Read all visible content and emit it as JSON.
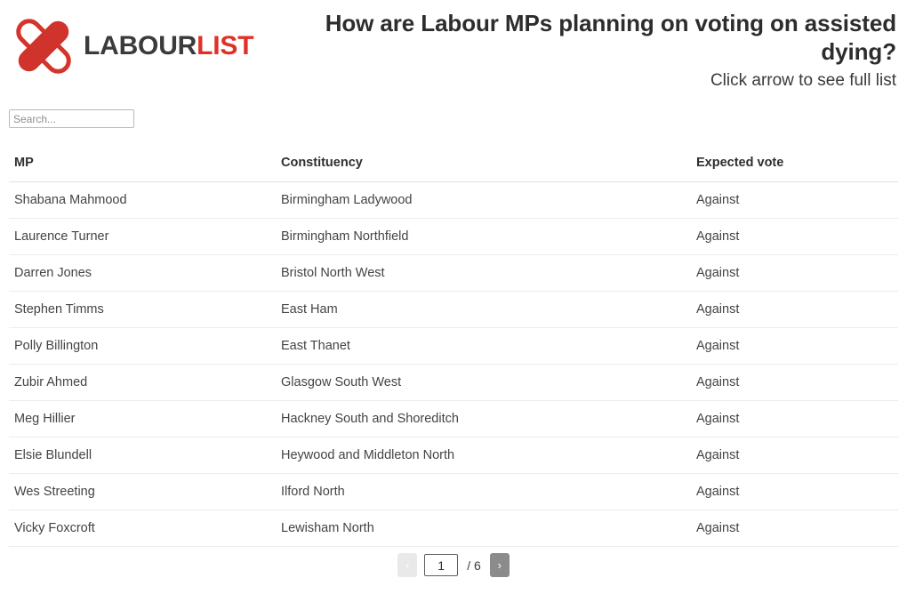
{
  "brand": {
    "logo_icon": "labourlist-x-icon",
    "name_part1": "LABOUR",
    "name_part2": "LIST",
    "color_red": "#e03127",
    "color_dark": "#3b3b3b"
  },
  "header": {
    "title": "How are Labour MPs planning on voting on assisted dying?",
    "subtitle": "Click arrow to see full list"
  },
  "search": {
    "placeholder": "Search...",
    "value": ""
  },
  "table": {
    "columns": [
      "MP",
      "Constituency",
      "Expected vote"
    ],
    "rows": [
      {
        "mp": "Shabana Mahmood",
        "constituency": "Birmingham Ladywood",
        "vote": "Against"
      },
      {
        "mp": "Laurence Turner",
        "constituency": "Birmingham Northfield",
        "vote": "Against"
      },
      {
        "mp": "Darren Jones",
        "constituency": "Bristol North West",
        "vote": "Against"
      },
      {
        "mp": "Stephen Timms",
        "constituency": "East Ham",
        "vote": "Against"
      },
      {
        "mp": "Polly Billington",
        "constituency": "East Thanet",
        "vote": "Against"
      },
      {
        "mp": "Zubir Ahmed",
        "constituency": "Glasgow South West",
        "vote": "Against"
      },
      {
        "mp": "Meg Hillier",
        "constituency": "Hackney South and Shoreditch",
        "vote": "Against"
      },
      {
        "mp": "Elsie Blundell",
        "constituency": "Heywood and Middleton North",
        "vote": "Against"
      },
      {
        "mp": "Wes Streeting",
        "constituency": "Ilford North",
        "vote": "Against"
      },
      {
        "mp": "Vicky Foxcroft",
        "constituency": "Lewisham North",
        "vote": "Against"
      }
    ]
  },
  "pagination": {
    "prev_label": "‹",
    "next_label": "›",
    "current_page": "1",
    "total_label": "/ 6"
  }
}
